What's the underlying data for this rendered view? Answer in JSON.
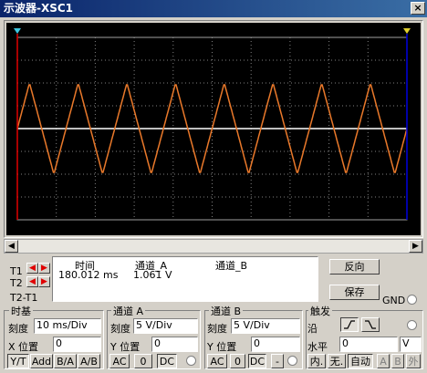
{
  "window": {
    "title": "示波器-XSC1",
    "close_glyph": "×"
  },
  "colors": {
    "channel_a": "#e8782a",
    "channel_b": "#ffffff",
    "background": "#000000",
    "grid": "#808080"
  },
  "cursors": {
    "t1_label": "T1",
    "t2_label": "T2",
    "diff_label": "T2-T1"
  },
  "readout": {
    "header_time": "时间",
    "header_a": "通道_A",
    "header_b": "通道_B",
    "row1_time": "180.012 ms",
    "row1_a": "1.061 V"
  },
  "buttons": {
    "reverse": "反向",
    "save": "保存",
    "gnd": "GND"
  },
  "timebase": {
    "title": "时基",
    "scale_label": "刻度",
    "scale_value": "10 ms/Div",
    "xpos_label": "X 位置",
    "xpos_value": "0",
    "modes": [
      "Y/T",
      "Add",
      "B/A",
      "A/B"
    ]
  },
  "channel_a": {
    "title": "通道 A",
    "scale_label": "刻度",
    "scale_value": "5  V/Div",
    "ypos_label": "Y 位置",
    "ypos_value": "0",
    "coupling": [
      "AC",
      "0",
      "DC"
    ]
  },
  "channel_b": {
    "title": "通道 B",
    "scale_label": "刻度",
    "scale_value": "5  V/Div",
    "ypos_label": "Y 位置",
    "ypos_value": "0",
    "coupling": [
      "AC",
      "0",
      "DC",
      "-"
    ]
  },
  "trigger": {
    "title": "触发",
    "edge_label": "沿",
    "level_label": "水平",
    "level_value": "0",
    "level_unit": "V",
    "modes": [
      "内.",
      "无.",
      "自动"
    ],
    "sources": [
      "A",
      "B",
      "外"
    ]
  },
  "chart_data": {
    "type": "line",
    "divisions_x": 10,
    "divisions_y": 8,
    "timebase_ms_per_div": 10,
    "volts_per_div": 5,
    "series": [
      {
        "name": "通道_A",
        "waveform": "triangle",
        "cycles_across_screen": 8,
        "amplitude_div": 2.0,
        "offset_div": 0
      },
      {
        "name": "通道_B",
        "waveform": "dc",
        "value_div": 0
      }
    ]
  }
}
